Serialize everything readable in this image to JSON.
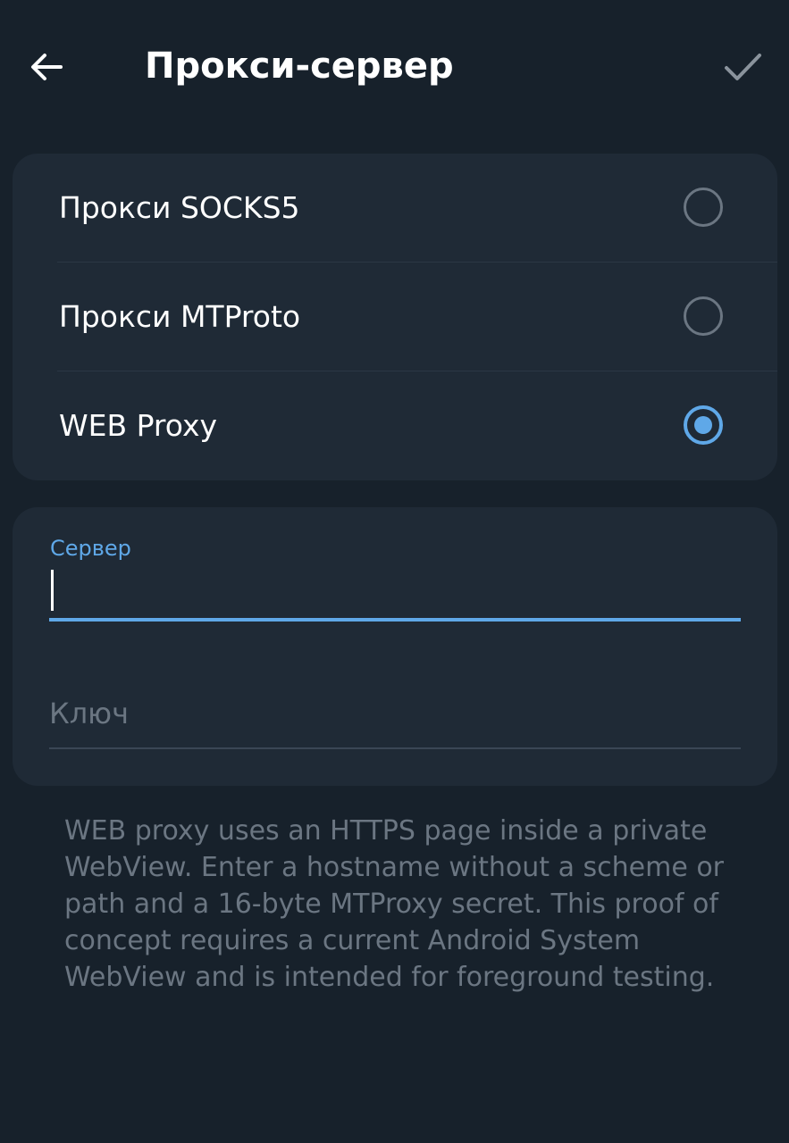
{
  "header": {
    "title": "Прокси-сервер"
  },
  "proxy_types": {
    "items": [
      {
        "label": "Прокси SOCKS5",
        "selected": false
      },
      {
        "label": "Прокси MTProto",
        "selected": false
      },
      {
        "label": "WEB Proxy",
        "selected": true
      }
    ]
  },
  "fields": {
    "server": {
      "label": "Сервер",
      "value": "",
      "placeholder": ""
    },
    "key": {
      "value": "",
      "placeholder": "Ключ"
    }
  },
  "help_text": "WEB proxy uses an HTTPS page inside a private WebView. Enter a hostname without a scheme or path and a 16-byte MTProxy secret. This proof of concept requires a current Android System WebView and is intended for foreground testing.",
  "colors": {
    "background": "#17212b",
    "card": "#1f2a36",
    "accent": "#5fa8e8",
    "muted_text": "#6b7682",
    "primary_text": "#ffffff"
  },
  "icons": {
    "back": "arrow-left-icon",
    "confirm": "check-icon"
  }
}
